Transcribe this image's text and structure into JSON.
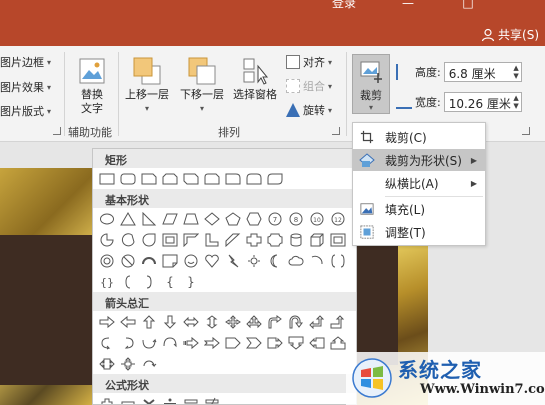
{
  "titlebar": {
    "login": "登录",
    "min": "—",
    "restore": "□"
  },
  "tabbar": {
    "share": "共享(S)"
  },
  "ribbon": {
    "picture_border": "图片边框",
    "picture_effects": "图片效果",
    "picture_layout": "图片版式",
    "alt_text": [
      "替换",
      "文字"
    ],
    "bring_forward": "上移一层",
    "send_backward": "下移一层",
    "selection_pane": "选择窗格",
    "align": "对齐",
    "group": "组合",
    "rotate": "旋转",
    "crop": "裁剪",
    "height_label": "高度:",
    "height_value": "6.8 厘米",
    "width_label": "宽度:",
    "width_value": "10.26 厘米",
    "group_accessibility": "辅助功能",
    "group_arrange": "排列"
  },
  "crop_menu": {
    "items": [
      {
        "label": "裁剪(C)",
        "icon": "crop-icon"
      },
      {
        "label": "裁剪为形状(S)",
        "icon": "crop-to-shape-icon",
        "submenu": true
      },
      {
        "label": "纵横比(A)",
        "icon": "",
        "submenu": true
      },
      {
        "label": "填充(L)",
        "icon": "fill-icon"
      },
      {
        "label": "调整(T)",
        "icon": "fit-icon"
      }
    ]
  },
  "shape_panel": {
    "sections": {
      "rectangles": "矩形",
      "basic_shapes": "基本形状",
      "block_arrows": "箭头总汇",
      "equation_shapes": "公式形状"
    },
    "number_shapes": [
      "7",
      "8",
      "10",
      "12"
    ],
    "brace_text": [
      "{",
      "}"
    ]
  },
  "watermark": {
    "brand": "系统之家",
    "url": "Www.Winwin7.com"
  }
}
